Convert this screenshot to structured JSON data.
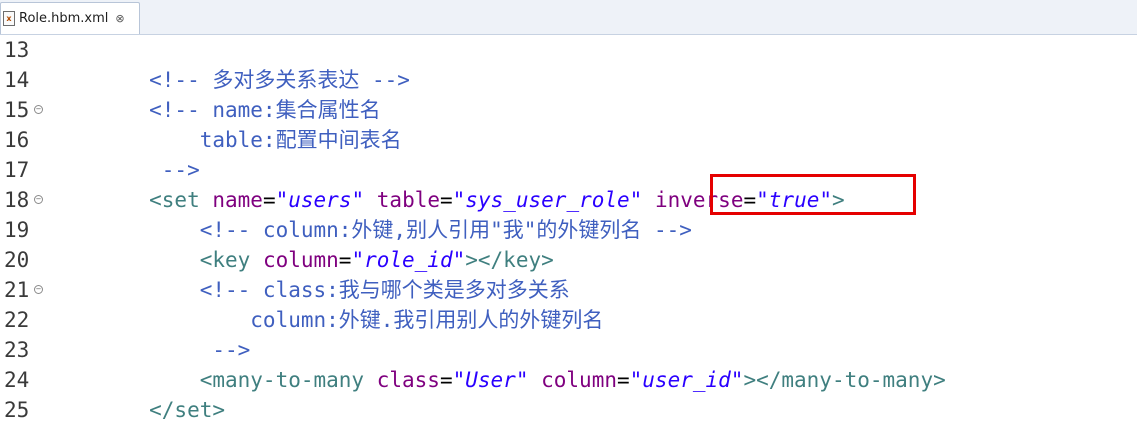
{
  "tab": {
    "title": "Role.hbm.xml",
    "close_glyph": "⊗",
    "icon": "xml-file-icon"
  },
  "colors": {
    "comment": "#3f5fbf",
    "tag": "#3f7f7f",
    "attribute": "#7f007f",
    "string": "#2a00ff",
    "highlight_box": "#e50000"
  },
  "lines": [
    {
      "num": "13",
      "fold": false,
      "tokens": []
    },
    {
      "num": "14",
      "fold": false,
      "tokens": [
        {
          "t": "        <!-- 多对多关系表达 -->",
          "c": "com"
        }
      ]
    },
    {
      "num": "15",
      "fold": true,
      "tokens": [
        {
          "t": "        <!-- name:集合属性名",
          "c": "com"
        }
      ]
    },
    {
      "num": "16",
      "fold": false,
      "tokens": [
        {
          "t": "            table:配置中间表名",
          "c": "com"
        }
      ]
    },
    {
      "num": "17",
      "fold": false,
      "tokens": [
        {
          "t": "         -->",
          "c": "com"
        }
      ]
    },
    {
      "num": "18",
      "fold": true,
      "tokens": [
        {
          "t": "        <set ",
          "c": "tag"
        },
        {
          "t": "name",
          "c": "attr"
        },
        {
          "t": "=",
          "c": "plain"
        },
        {
          "t": "\"users\"",
          "c": "str"
        },
        {
          "t": " ",
          "c": "plain"
        },
        {
          "t": "table",
          "c": "attr"
        },
        {
          "t": "=",
          "c": "plain"
        },
        {
          "t": "\"sys_user_role\"",
          "c": "str"
        },
        {
          "t": " ",
          "c": "plain"
        },
        {
          "t": "inverse",
          "c": "attr"
        },
        {
          "t": "=",
          "c": "plain"
        },
        {
          "t": "\"true\"",
          "c": "str"
        },
        {
          "t": ">",
          "c": "tag"
        }
      ]
    },
    {
      "num": "19",
      "fold": false,
      "tokens": [
        {
          "t": "            <!-- column:外键,别人引用\"我\"的外键列名 -->",
          "c": "com"
        }
      ]
    },
    {
      "num": "20",
      "fold": false,
      "tokens": [
        {
          "t": "            <key ",
          "c": "tag"
        },
        {
          "t": "column",
          "c": "attr"
        },
        {
          "t": "=",
          "c": "plain"
        },
        {
          "t": "\"role_id\"",
          "c": "str"
        },
        {
          "t": "></key>",
          "c": "tag"
        }
      ]
    },
    {
      "num": "21",
      "fold": true,
      "tokens": [
        {
          "t": "            <!-- class:我与哪个类是多对多关系",
          "c": "com"
        }
      ]
    },
    {
      "num": "22",
      "fold": false,
      "tokens": [
        {
          "t": "                column:外键.我引用别人的外键列名",
          "c": "com"
        }
      ]
    },
    {
      "num": "23",
      "fold": false,
      "tokens": [
        {
          "t": "             -->",
          "c": "com"
        }
      ]
    },
    {
      "num": "24",
      "fold": false,
      "tokens": [
        {
          "t": "            <many-to-many ",
          "c": "tag"
        },
        {
          "t": "class",
          "c": "attr"
        },
        {
          "t": "=",
          "c": "plain"
        },
        {
          "t": "\"User\"",
          "c": "str"
        },
        {
          "t": " ",
          "c": "plain"
        },
        {
          "t": "column",
          "c": "attr"
        },
        {
          "t": "=",
          "c": "plain"
        },
        {
          "t": "\"user_id\"",
          "c": "str"
        },
        {
          "t": "></many-to-many>",
          "c": "tag"
        }
      ]
    },
    {
      "num": "25",
      "fold": false,
      "tokens": [
        {
          "t": "        </set>",
          "c": "tag"
        }
      ]
    }
  ]
}
